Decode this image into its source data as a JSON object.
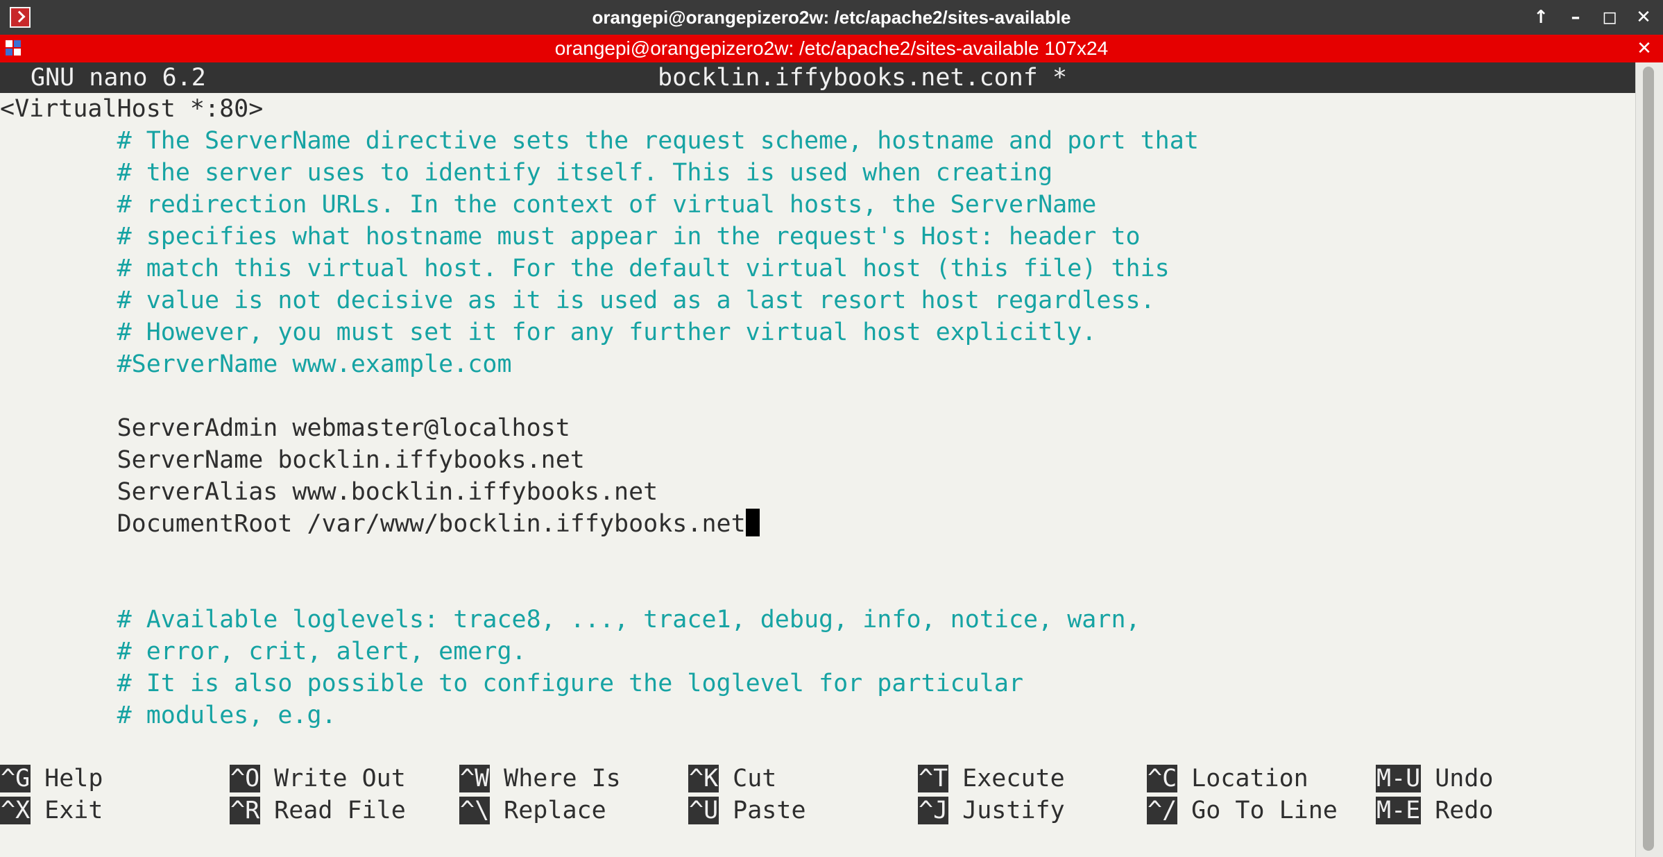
{
  "window": {
    "title": "orangepi@orangepizero2w: /etc/apache2/sites-available",
    "btn_up": "↑",
    "btn_min": "–",
    "btn_max": "◻",
    "btn_close": "✕"
  },
  "terminal_window": {
    "title": "orangepi@orangepizero2w: /etc/apache2/sites-available 107x24",
    "btn_close": "✕"
  },
  "nano": {
    "version": "GNU nano 6.2",
    "filename": "bocklin.iffybooks.net.conf *"
  },
  "lines": [
    "<VirtualHost *:80>",
    "        # The ServerName directive sets the request scheme, hostname and port that",
    "        # the server uses to identify itself. This is used when creating",
    "        # redirection URLs. In the context of virtual hosts, the ServerName",
    "        # specifies what hostname must appear in the request's Host: header to",
    "        # match this virtual host. For the default virtual host (this file) this",
    "        # value is not decisive as it is used as a last resort host regardless.",
    "        # However, you must set it for any further virtual host explicitly.",
    "        #ServerName www.example.com",
    "",
    "        ServerAdmin webmaster@localhost",
    "        ServerName bocklin.iffybooks.net",
    "        ServerAlias www.bocklin.iffybooks.net",
    "        DocumentRoot /var/www/bocklin.iffybooks.net",
    "",
    "",
    "        # Available loglevels: trace8, ..., trace1, debug, info, notice, warn,",
    "        # error, crit, alert, emerg.",
    "        # It is also possible to configure the loglevel for particular",
    "        # modules, e.g."
  ],
  "shortcuts": [
    {
      "key": "^G",
      "label": "Help"
    },
    {
      "key": "^O",
      "label": "Write Out"
    },
    {
      "key": "^W",
      "label": "Where Is"
    },
    {
      "key": "^K",
      "label": "Cut"
    },
    {
      "key": "^T",
      "label": "Execute"
    },
    {
      "key": "^C",
      "label": "Location"
    },
    {
      "key": "M-U",
      "label": "Undo"
    },
    {
      "key": "^X",
      "label": "Exit"
    },
    {
      "key": "^R",
      "label": "Read File"
    },
    {
      "key": "^\\",
      "label": "Replace"
    },
    {
      "key": "^U",
      "label": "Paste"
    },
    {
      "key": "^J",
      "label": "Justify"
    },
    {
      "key": "^/",
      "label": "Go To Line"
    },
    {
      "key": "M-E",
      "label": "Redo"
    }
  ],
  "colors": {
    "comment": "#16a3a3",
    "text": "#2e2e2e",
    "terminal_bar": "#e50000",
    "nano_bar": "#333333"
  }
}
